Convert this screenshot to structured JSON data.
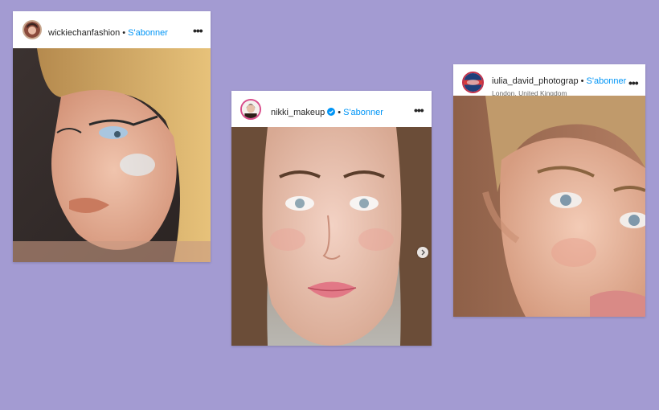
{
  "posts": [
    {
      "username": "wickiechanfashion",
      "separator": "•",
      "follow_label": "S'abonner",
      "more_label": "•••",
      "photo_icon": "portrait-photo"
    },
    {
      "username": "nikki_makeup",
      "separator": "•",
      "follow_label": "S'abonner",
      "more_label": "•••",
      "verified": true,
      "photo_icon": "portrait-photo",
      "carousel_icon": "chevron-right-icon"
    },
    {
      "username": "iulia_david_photograp",
      "separator": "•",
      "follow_label": "S'abonner",
      "location": "London, United Kingdom",
      "more_label": "•••",
      "photo_icon": "portrait-photo"
    }
  ],
  "colors": {
    "background": "#a39bd2",
    "link": "#0095f6",
    "text": "#262626"
  }
}
